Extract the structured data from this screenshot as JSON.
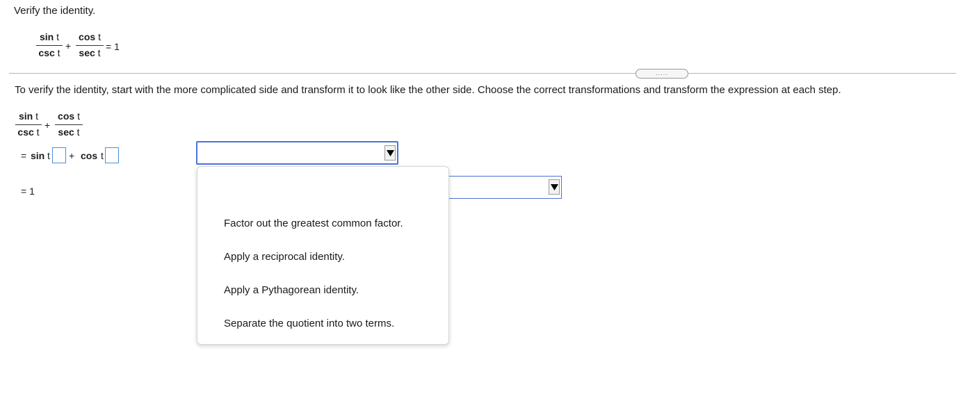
{
  "question": {
    "prompt": "Verify the identity.",
    "identity": {
      "term1": {
        "num_fn": "sin",
        "num_var": "t",
        "den_fn": "csc",
        "den_var": "t"
      },
      "plus": "+",
      "term2": {
        "num_fn": "cos",
        "num_var": "t",
        "den_fn": "sec",
        "den_var": "t"
      },
      "rhs": "= 1"
    }
  },
  "more_button": {
    "label": "....."
  },
  "instruction": "To verify the identity, start with the more complicated side and transform it to look like the other side. Choose the correct transformations and transform the expression at each step.",
  "work": {
    "lhs": {
      "term1": {
        "num_fn": "sin",
        "num_var": "t",
        "den_fn": "csc",
        "den_var": "t"
      },
      "plus": "+",
      "term2": {
        "num_fn": "cos",
        "num_var": "t",
        "den_fn": "sec",
        "den_var": "t"
      }
    },
    "step1": {
      "eq": "=",
      "fn1": "sin",
      "var1": "t",
      "plus": "+",
      "fn2": "cos",
      "var2": "t",
      "blank1": "",
      "blank2": ""
    },
    "step2": {
      "text": "= 1"
    }
  },
  "dropdowns": {
    "step1_select": {
      "value": ""
    },
    "step2_select": {
      "value": ""
    },
    "options": [
      "",
      "Factor out the greatest common factor.",
      "Apply a reciprocal identity.",
      "Apply a Pythagorean identity.",
      "Separate the quotient into two terms."
    ]
  },
  "colors": {
    "accent": "#4a72d8",
    "focus_border": "#4a8fd8"
  }
}
